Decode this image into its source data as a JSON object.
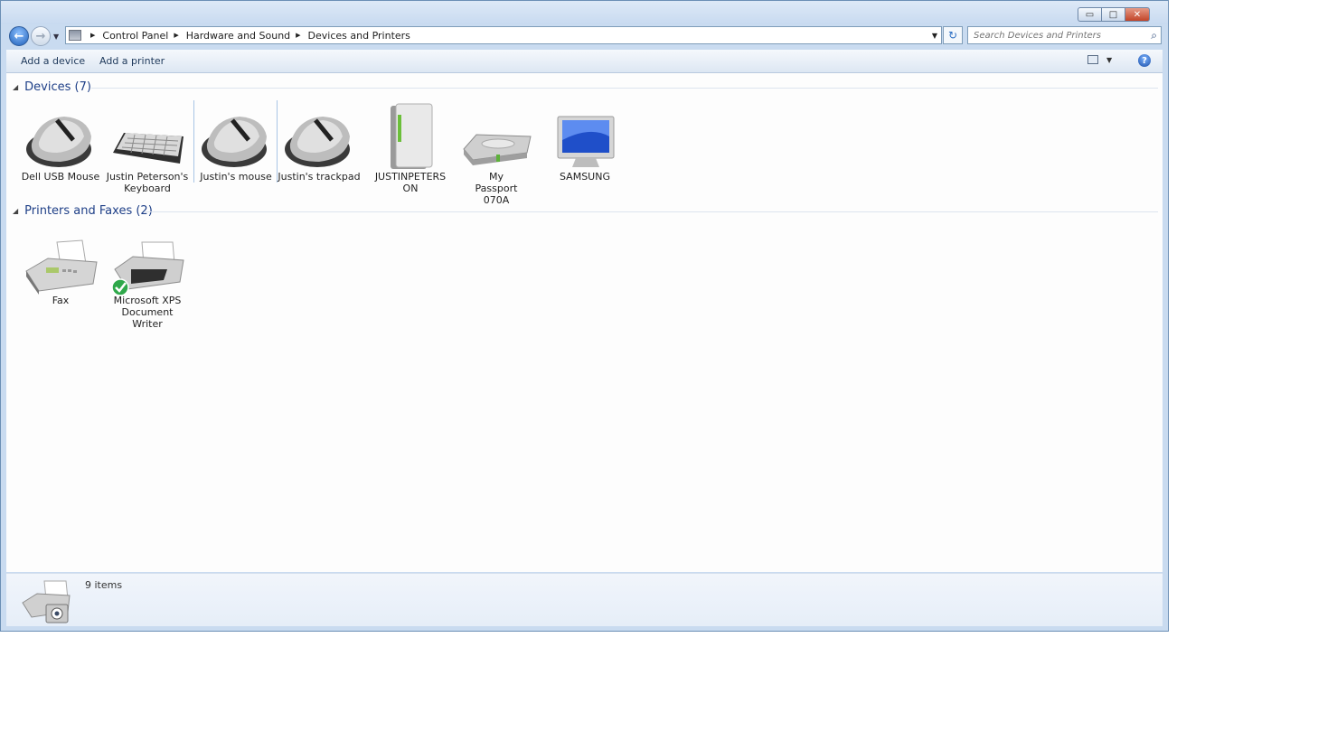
{
  "window": {
    "min_glyph": "▭",
    "max_glyph": "□",
    "close_glyph": "✕"
  },
  "nav": {
    "back_glyph": "←",
    "forward_glyph": "→",
    "breadcrumb": [
      "Control Panel",
      "Hardware and Sound",
      "Devices and Printers"
    ],
    "search_placeholder": "Search Devices and Printers",
    "search_glyph": "⌕",
    "refresh_glyph": "↻"
  },
  "commands": {
    "add_device": "Add a device",
    "add_printer": "Add a printer",
    "help_glyph": "?"
  },
  "groups": {
    "devices": {
      "title": "Devices (7)",
      "items": [
        {
          "label": "Dell USB Mouse",
          "icon": "mouse-icon"
        },
        {
          "label": "Justin Peterson's Keyboard",
          "icon": "keyboard-icon"
        },
        {
          "label": "Justin's mouse",
          "icon": "mouse-icon"
        },
        {
          "label": "Justin's trackpad",
          "icon": "mouse-icon"
        },
        {
          "label": "JUSTINPETERSON",
          "icon": "computer-tower-icon"
        },
        {
          "label": "My Passport 070A",
          "icon": "external-drive-icon"
        },
        {
          "label": "SAMSUNG",
          "icon": "monitor-icon"
        }
      ]
    },
    "printers": {
      "title": "Printers and Faxes (2)",
      "items": [
        {
          "label": "Fax",
          "icon": "fax-icon"
        },
        {
          "label": "Microsoft XPS Document Writer",
          "icon": "printer-icon",
          "default": true
        }
      ]
    }
  },
  "status": {
    "count_text": "9 items"
  }
}
